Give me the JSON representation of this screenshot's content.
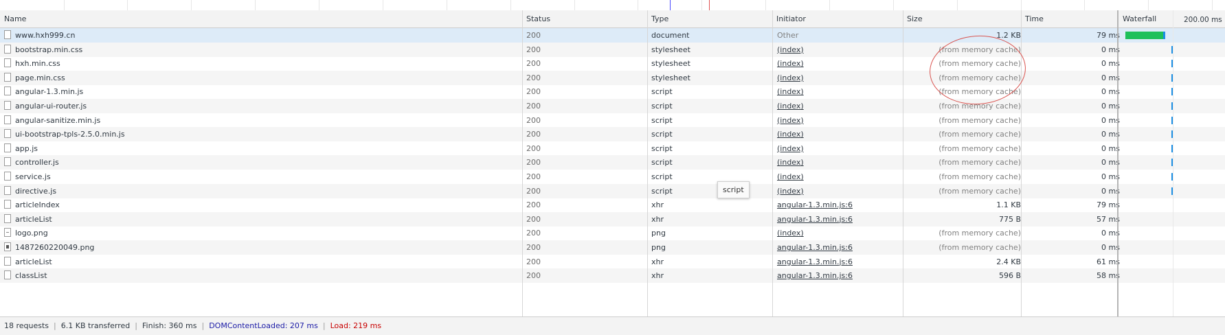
{
  "overview": {
    "colors": {
      "dcl_marker": "#4b4bff",
      "load_marker": "#e05050"
    }
  },
  "columns": {
    "name": "Name",
    "status": "Status",
    "type": "Type",
    "initiator": "Initiator",
    "size": "Size",
    "time": "Time",
    "waterfall": "Waterfall",
    "waterfall_scale": "200.00 ms"
  },
  "requests": [
    {
      "name": "www.hxh999.cn",
      "status": "200",
      "type": "document",
      "initiator": "Other",
      "size": "1.2 KB",
      "time": "79 ms",
      "icon": "document-icon"
    },
    {
      "name": "bootstrap.min.css",
      "status": "200",
      "type": "stylesheet",
      "initiator": "(index)",
      "size": "(from memory cache)",
      "time": "0 ms",
      "icon": "document-icon"
    },
    {
      "name": "hxh.min.css",
      "status": "200",
      "type": "stylesheet",
      "initiator": "(index)",
      "size": "(from memory cache)",
      "time": "0 ms",
      "icon": "document-icon"
    },
    {
      "name": "page.min.css",
      "status": "200",
      "type": "stylesheet",
      "initiator": "(index)",
      "size": "(from memory cache)",
      "time": "0 ms",
      "icon": "document-icon"
    },
    {
      "name": "angular-1.3.min.js",
      "status": "200",
      "type": "script",
      "initiator": "(index)",
      "size": "(from memory cache)",
      "time": "0 ms",
      "icon": "document-icon"
    },
    {
      "name": "angular-ui-router.js",
      "status": "200",
      "type": "script",
      "initiator": "(index)",
      "size": "(from memory cache)",
      "time": "0 ms",
      "icon": "document-icon"
    },
    {
      "name": "angular-sanitize.min.js",
      "status": "200",
      "type": "script",
      "initiator": "(index)",
      "size": "(from memory cache)",
      "time": "0 ms",
      "icon": "document-icon"
    },
    {
      "name": "ui-bootstrap-tpls-2.5.0.min.js",
      "status": "200",
      "type": "script",
      "initiator": "(index)",
      "size": "(from memory cache)",
      "time": "0 ms",
      "icon": "document-icon"
    },
    {
      "name": "app.js",
      "status": "200",
      "type": "script",
      "initiator": "(index)",
      "size": "(from memory cache)",
      "time": "0 ms",
      "icon": "document-icon"
    },
    {
      "name": "controller.js",
      "status": "200",
      "type": "script",
      "initiator": "(index)",
      "size": "(from memory cache)",
      "time": "0 ms",
      "icon": "document-icon"
    },
    {
      "name": "service.js",
      "status": "200",
      "type": "script",
      "initiator": "(index)",
      "size": "(from memory cache)",
      "time": "0 ms",
      "icon": "document-icon"
    },
    {
      "name": "directive.js",
      "status": "200",
      "type": "script",
      "initiator": "(index)",
      "size": "(from memory cache)",
      "time": "0 ms",
      "icon": "document-icon"
    },
    {
      "name": "articleIndex",
      "status": "200",
      "type": "xhr",
      "initiator": "angular-1.3.min.js:6",
      "size": "1.1 KB",
      "time": "79 ms",
      "icon": "document-icon"
    },
    {
      "name": "articleList",
      "status": "200",
      "type": "xhr",
      "initiator": "angular-1.3.min.js:6",
      "size": "775 B",
      "time": "57 ms",
      "icon": "document-icon"
    },
    {
      "name": "logo.png",
      "status": "200",
      "type": "png",
      "initiator": "(index)",
      "size": "(from memory cache)",
      "time": "0 ms",
      "icon": "png-icon"
    },
    {
      "name": "1487260220049.png",
      "status": "200",
      "type": "png",
      "initiator": "angular-1.3.min.js:6",
      "size": "(from memory cache)",
      "time": "0 ms",
      "icon": "image-icon"
    },
    {
      "name": "articleList",
      "status": "200",
      "type": "xhr",
      "initiator": "angular-1.3.min.js:6",
      "size": "2.4 KB",
      "time": "61 ms",
      "icon": "document-icon"
    },
    {
      "name": "classList",
      "status": "200",
      "type": "xhr",
      "initiator": "angular-1.3.min.js:6",
      "size": "596 B",
      "time": "58 ms",
      "icon": "document-icon"
    }
  ],
  "tooltip": {
    "text": "script"
  },
  "statusbar": {
    "requests": "18 requests",
    "transferred": "6.1 KB transferred",
    "finish": "Finish: 360 ms",
    "dcl": "DOMContentLoaded: 207 ms",
    "load": "Load: 219 ms"
  },
  "colors": {
    "waterfall_green": "#1ec05a",
    "waterfall_blue": "#1b8ee3",
    "annotation": "#d9534f",
    "selected_row": "#ddebf8"
  }
}
